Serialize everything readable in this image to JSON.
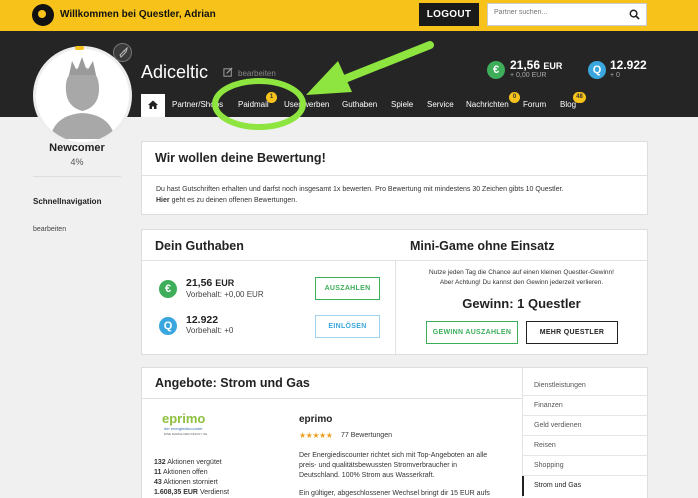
{
  "topbar": {
    "welcome": "Willkommen bei Questler, Adrian",
    "logout_label": "LOGOUT",
    "search_placeholder": "Partner suchen..."
  },
  "profile": {
    "username": "Adiceltic",
    "edit_text": "bearbeiten",
    "level": "Newcomer",
    "progress": "4%"
  },
  "balances": {
    "eur_symbol": "€",
    "eur_value": "21,56",
    "eur_unit": "EUR",
    "eur_sub": "+ 0,00 EUR",
    "q_symbol": "Q",
    "q_value": "12.922",
    "q_sub": "+ 0"
  },
  "nav": {
    "items": [
      {
        "label": "Partner/Shops"
      },
      {
        "label": "Paidmail",
        "badge": "1"
      },
      {
        "label": "User werben"
      },
      {
        "label": "Guthaben"
      },
      {
        "label": "Spiele"
      },
      {
        "label": "Service"
      },
      {
        "label": "Nachrichten",
        "badge": "0"
      },
      {
        "label": "Forum"
      },
      {
        "label": "Blog",
        "badge": "48"
      }
    ]
  },
  "sidebar": {
    "quicknav": "Schnellnavigation",
    "edit": "bearbeiten"
  },
  "rating": {
    "title": "Wir wollen deine Bewertung!",
    "line1": "Du hast Gutschriften erhalten und darfst noch insgesamt 1x bewerten. Pro Bewertung mit mindestens 30 Zeichen gibts 10 Questler.",
    "line2_link": "Hier",
    "line2_rest": " geht es zu deinen offenen Bewertungen."
  },
  "guthaben": {
    "title": "Dein Guthaben",
    "eur_value": "21,56",
    "eur_unit": "EUR",
    "eur_reserved": "Vorbehalt: +0,00 EUR",
    "payout_label": "AUSZAHLEN",
    "q_value": "12.922",
    "q_reserved": "Vorbehalt: +0",
    "redeem_label": "EINLÖSEN"
  },
  "minigame": {
    "title": "Mini-Game ohne Einsatz",
    "line1": "Nutze jeden Tag die Chance auf einen kleinen Questler-Gewinn!",
    "line2": "Aber Achtung! Du kannst den Gewinn jederzeit verlieren.",
    "win": "Gewinn: 1 Questler",
    "payout_label": "GEWINN AUSZAHLEN",
    "more_label": "MEHR QUESTLER"
  },
  "offers": {
    "title": "Angebote: Strom und Gas",
    "logo_text": "eprimo",
    "logo_sub": "der energiediscounter",
    "logo_sub2": "EINE MARKE DER INNOGY SE",
    "stats": [
      {
        "num": "132",
        "label": "Aktionen vergütet"
      },
      {
        "num": "11",
        "label": "Aktionen offen"
      },
      {
        "num": "43",
        "label": "Aktionen storniert"
      },
      {
        "num": "1.608,35 EUR",
        "label": "Verdienst"
      }
    ],
    "partner_name": "eprimo",
    "rating": 5,
    "reviews": "77 Bewertungen",
    "desc1": "Der Energiediscounter richtet sich mit Top-Angeboten an alle",
    "desc2": "preis- und qualitätsbewussten Stromverbraucher in",
    "desc3": "Deutschland. 100% Strom aus Wasserkraft.",
    "desc4": "Ein gültiger, abgeschlossener Wechsel bringt dir 15 EUR aufs",
    "categories": [
      "Dienstleistungen",
      "Finanzen",
      "Geld verdienen",
      "Reisen",
      "Shopping",
      "Strom und Gas"
    ]
  },
  "colors": {
    "brand_yellow": "#f7c31a",
    "header_dark": "#252525",
    "eur_green": "#3fae5b",
    "q_blue": "#39a6dd",
    "annotation_green": "#8ee53f"
  }
}
